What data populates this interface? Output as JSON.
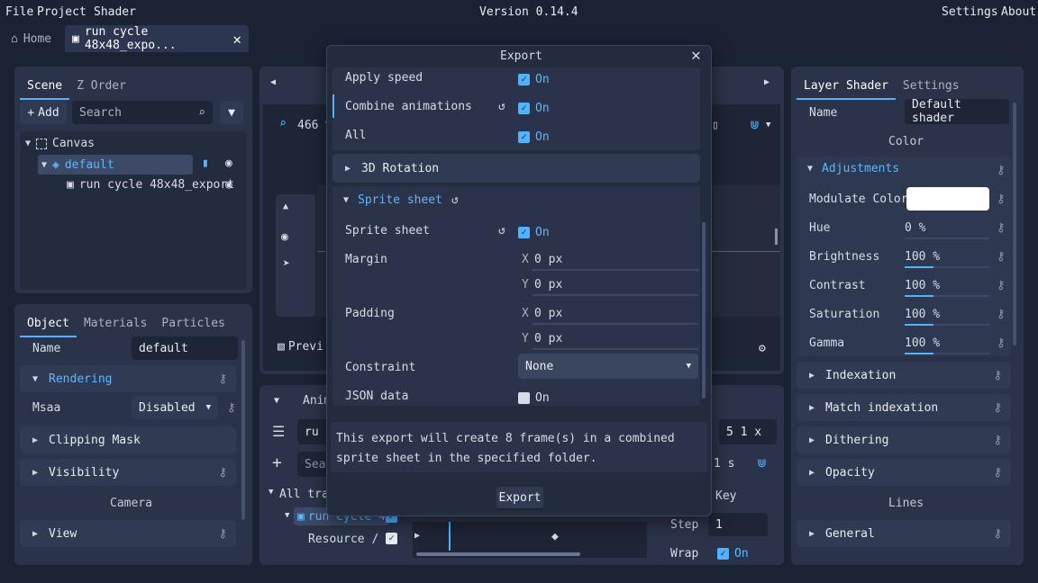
{
  "menu": {
    "file": "File",
    "project": "Project",
    "shader": "Shader",
    "version": "Version 0.14.4",
    "settings": "Settings",
    "about": "About"
  },
  "tabs": {
    "home": "Home",
    "doc": "run cycle 48x48_expo..."
  },
  "scene": {
    "tab_scene": "Scene",
    "tab_zorder": "Z Order",
    "add": "Add",
    "search_placeholder": "Search",
    "tree": {
      "canvas": "Canvas",
      "default": "default",
      "item": "run cycle 48x48_export"
    }
  },
  "object": {
    "tab_object": "Object",
    "tab_materials": "Materials",
    "tab_particles": "Particles",
    "name_label": "Name",
    "name_value": "default",
    "rendering": "Rendering",
    "msaa_label": "Msaa",
    "msaa_value": "Disabled",
    "clipping": "Clipping Mask",
    "visibility": "Visibility",
    "camera": "Camera",
    "view": "View"
  },
  "viewport": {
    "zoom": "466 %",
    "preview": "Previ"
  },
  "anim": {
    "tab": "Anim",
    "ru": "ru",
    "search": "Sear",
    "all_tracks": "All track",
    "track": "run cycle 4",
    "resource": "Resource /",
    "scale": "5 1 x",
    "seconds": "1 s",
    "key": "Key",
    "step_label": "Step",
    "step_value": "1",
    "wrap_label": "Wrap",
    "wrap_value": "On"
  },
  "dialog": {
    "title": "Export",
    "rows": {
      "apply_speed": "Apply speed",
      "combine": "Combine animations",
      "all": "All",
      "rotation": "3D Rotation",
      "sprite_header": "Sprite sheet",
      "sprite": "Sprite sheet",
      "margin": "Margin",
      "padding": "Padding",
      "constraint": "Constraint",
      "constraint_value": "None",
      "json": "JSON data",
      "on": "On",
      "x": "X",
      "y": "Y",
      "zero": "0 px"
    },
    "message": "This export will create 8 frame(s) in a combined sprite sheet in the specified folder.",
    "button": "Export"
  },
  "shader": {
    "tab_layer": "Layer Shader",
    "tab_settings": "Settings",
    "name_label": "Name",
    "name_value": "Default shader",
    "color": "Color",
    "adjustments": "Adjustments",
    "modulate": "Modulate Color",
    "hue": "Hue",
    "hue_value": "0 %",
    "brightness": "Brightness",
    "contrast": "Contrast",
    "saturation": "Saturation",
    "gamma": "Gamma",
    "pct": "100 %",
    "indexation": "Indexation",
    "match": "Match indexation",
    "dithering": "Dithering",
    "opacity": "Opacity",
    "lines": "Lines",
    "general": "General"
  }
}
